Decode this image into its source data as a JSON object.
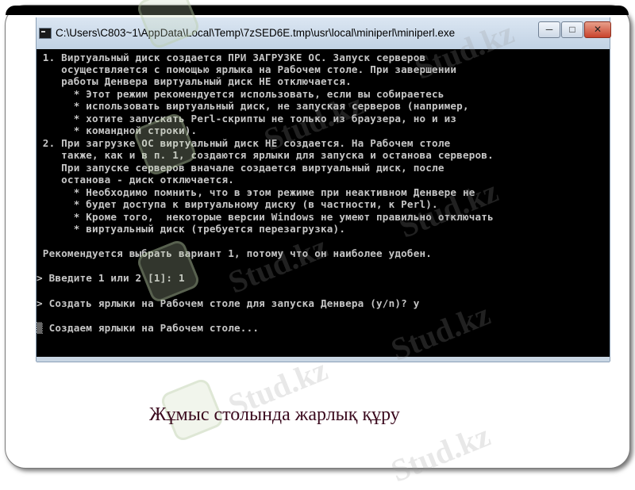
{
  "window": {
    "title": "C:\\Users\\C803~1\\AppData\\Local\\Temp\\7zSED6E.tmp\\usr\\local\\miniperl\\miniperl.exe",
    "min_label": "─",
    "max_label": "□",
    "close_label": "✕"
  },
  "console": {
    "lines": [
      " 1. Виртуальный диск создается ПРИ ЗАГРУЗКЕ ОС. Запуск серверов",
      "    осуществляется с помощью ярлыка на Рабочем столе. При завершении",
      "    работы Денвера виртуальный диск НЕ отключается.",
      "      * Этот режим рекомендуется использовать, если вы собираетесь",
      "      * использовать виртуальный диск, не запуская серверов (например,",
      "      * хотите запускать Perl-скрипты не только из браузера, но и из",
      "      * командной строки).",
      " 2. При загрузке ОС виртуальный диск НЕ создается. На Рабочем столе",
      "    также, как и в п. 1, создаются ярлыки для запуска и останова серверов.",
      "    При запуске серверов вначале создается виртуальный диск, после",
      "    останова - диск отключается.",
      "      * Необходимо помнить, что в этом режиме при неактивном Денвере не",
      "      * будет доступа к виртуальному диску (в частности, к Perl).",
      "      * Кроме того,  некоторые версии Windows не умеют правильно отключать",
      "      * виртуальный диск (требуется перезагрузка).",
      " Рекомендуется выбрать вариант 1, потому что он наиболее удобен.",
      "> Введите 1 или 2 [1]: 1",
      "> Создать ярлыки на Рабочем столе для запуска Денвера (y/n)? y",
      "▒ Создаем ярлыки на Рабочем столе..."
    ]
  },
  "caption": "Жұмыс столында жарлық құру",
  "watermark": "Stud.kz"
}
